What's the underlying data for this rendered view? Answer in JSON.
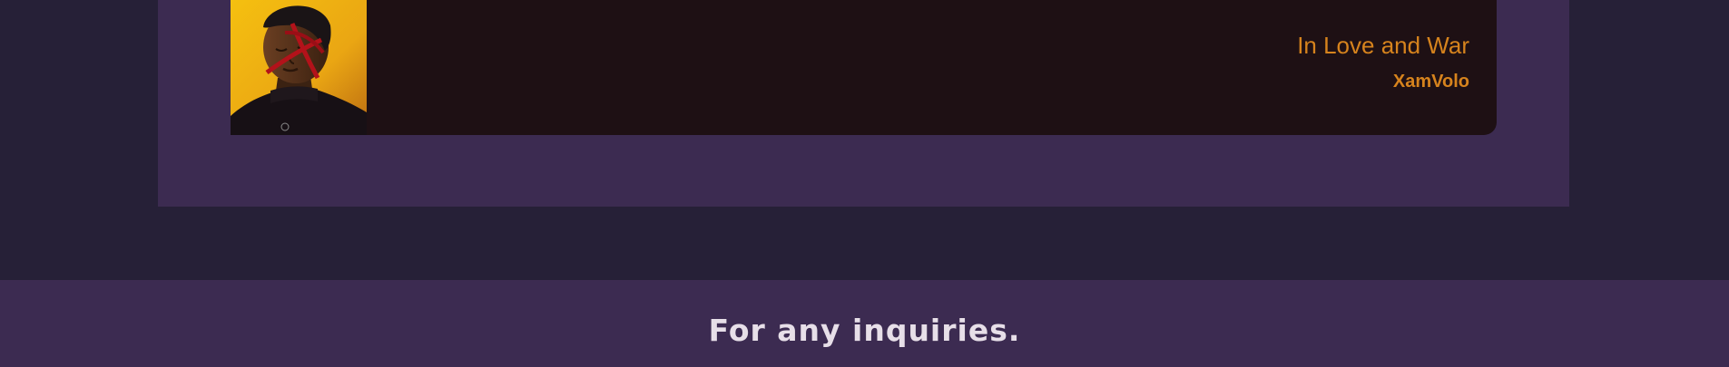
{
  "album": {
    "title": "In Love and War",
    "artist": "XamVolo",
    "cover_icon": "album-cover-art"
  },
  "footer": {
    "heading": "For any inquiries."
  },
  "colors": {
    "page_background": "#262037",
    "panel_background": "#3c2b51",
    "card_background": "#1e1014",
    "accent": "#d6831d",
    "footer_text": "#e7dfe8"
  }
}
